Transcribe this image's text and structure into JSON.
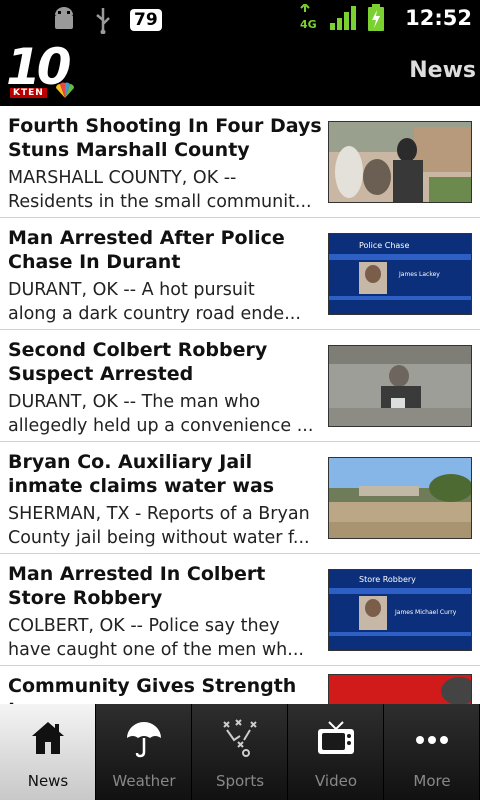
{
  "status_bar": {
    "battery_level": "79",
    "network": "4G",
    "time": "12:52"
  },
  "app": {
    "logo_number": "10",
    "logo_call_sign": "KTEN",
    "header_title": "News"
  },
  "news": [
    {
      "title": "Fourth Shooting In Four Days Stuns Marshall County Resid...",
      "summary_line1": "MARSHALL COUNTY, OK --",
      "summary_line2": "Residents in the small communit..."
    },
    {
      "title": "Man Arrested After Police Chase In Durant",
      "summary_line1": "DURANT, OK -- A hot pursuit",
      "summary_line2": "along a dark country road ende...",
      "thumb_caption_top": "Police Chase",
      "thumb_caption_name": "James Lackey"
    },
    {
      "title": "Second Colbert Robbery Suspect Arrested",
      "summary_line1": "DURANT, OK -- The man who",
      "summary_line2": "allegedly held up a convenience ..."
    },
    {
      "title": "Bryan Co. Auxiliary Jail inmate claims water was shut off for...",
      "summary_line1": "SHERMAN, TX - Reports of a Bryan",
      "summary_line2": "County jail being without water f..."
    },
    {
      "title": "Man Arrested In Colbert Store Robbery",
      "summary_line1": "COLBERT, OK -- Police say they",
      "summary_line2": "have caught one of the men wh...",
      "thumb_caption_top": "Store Robbery",
      "thumb_caption_name": "James Michael Curry"
    },
    {
      "title": "Community Gives Strength to",
      "summary_line1": "",
      "summary_line2": ""
    }
  ],
  "tabs": [
    {
      "label": "News",
      "icon": "home-icon",
      "active": true
    },
    {
      "label": "Weather",
      "icon": "umbrella-icon",
      "active": false
    },
    {
      "label": "Sports",
      "icon": "playbook-icon",
      "active": false
    },
    {
      "label": "Video",
      "icon": "tv-icon",
      "active": false
    },
    {
      "label": "More",
      "icon": "more-dots-icon",
      "active": false
    }
  ],
  "colors": {
    "bar_background": "#000000",
    "accent_green": "#7bd12f",
    "list_background": "#ffffff",
    "active_tab": "#e6e6e6"
  }
}
